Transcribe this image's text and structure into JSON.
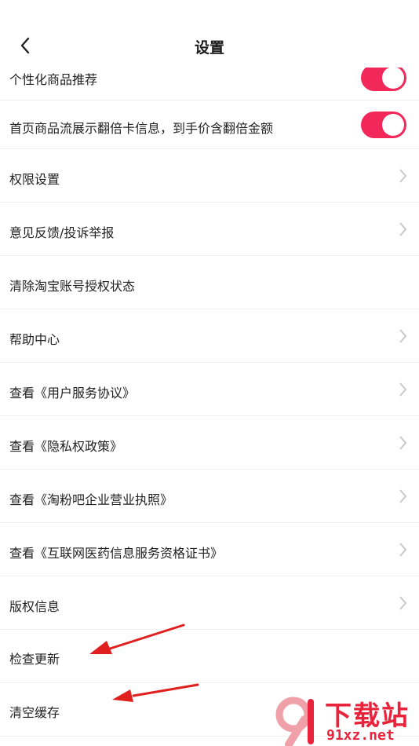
{
  "header": {
    "title": "设置"
  },
  "rows": [
    {
      "label": "个性化商品推荐",
      "control": "toggle",
      "on": true
    },
    {
      "label": "首页商品流展示翻倍卡信息，到手价含翻倍金额",
      "control": "toggle",
      "on": true
    },
    {
      "label": "权限设置",
      "control": "chevron"
    },
    {
      "label": "意见反馈/投诉举报",
      "control": "chevron"
    },
    {
      "label": "清除淘宝账号授权状态",
      "control": "none"
    },
    {
      "label": "帮助中心",
      "control": "chevron"
    },
    {
      "label": "查看《用户服务协议》",
      "control": "chevron"
    },
    {
      "label": "查看《隐私权政策》",
      "control": "chevron"
    },
    {
      "label": "查看《淘粉吧企业营业执照》",
      "control": "chevron"
    },
    {
      "label": "查看《互联网医药信息服务资格证书》",
      "control": "chevron"
    },
    {
      "label": "版权信息",
      "control": "chevron"
    },
    {
      "label": "检查更新",
      "control": "none"
    },
    {
      "label": "清空缓存",
      "control": "none"
    }
  ],
  "watermark": {
    "text_main": "下载站",
    "text_url": "91xz.net"
  },
  "colors": {
    "toggle_on": "#f2275a",
    "arrow": "#e0201e",
    "chevron": "#c8c8c8",
    "divider": "#efefef"
  }
}
